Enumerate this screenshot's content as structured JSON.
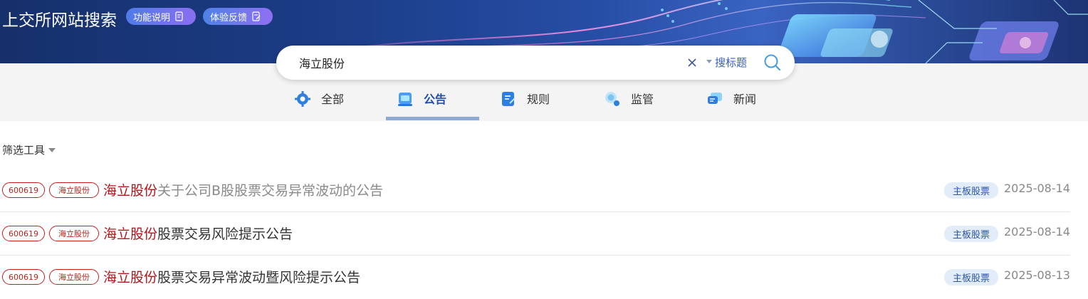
{
  "header": {
    "title": "上交所网站搜索",
    "function_label": "功能说明",
    "feedback_label": "体验反馈"
  },
  "search": {
    "query": "海立股份",
    "scope_label": "搜标题"
  },
  "tabs": [
    {
      "label": "全部",
      "icon": "gear-icon",
      "active": false
    },
    {
      "label": "公告",
      "icon": "announcement-icon",
      "active": true
    },
    {
      "label": "规则",
      "icon": "rules-icon",
      "active": false
    },
    {
      "label": "监管",
      "icon": "supervision-icon",
      "active": false
    },
    {
      "label": "新闻",
      "icon": "news-icon",
      "active": false
    }
  ],
  "filter": {
    "label": "筛选工具"
  },
  "results": [
    {
      "code": "600619",
      "name": "海立股份",
      "title_highlight": "海立股份",
      "title_rest": "关于公司B股股票交易异常波动的公告",
      "visited": true,
      "board": "主板股票",
      "date": "2025-08-14"
    },
    {
      "code": "600619",
      "name": "海立股份",
      "title_highlight": "海立股份",
      "title_rest": "股票交易风险提示公告",
      "visited": false,
      "board": "主板股票",
      "date": "2025-08-14"
    },
    {
      "code": "600619",
      "name": "海立股份",
      "title_highlight": "海立股份",
      "title_rest": "股票交易异常波动暨风险提示公告",
      "visited": false,
      "board": "主板股票",
      "date": "2025-08-13"
    }
  ],
  "colors": {
    "highlight": "#b3161b",
    "tag_border": "#c81e1e",
    "accent": "#1e4fa8",
    "badge_bg": "#e3edf9"
  }
}
